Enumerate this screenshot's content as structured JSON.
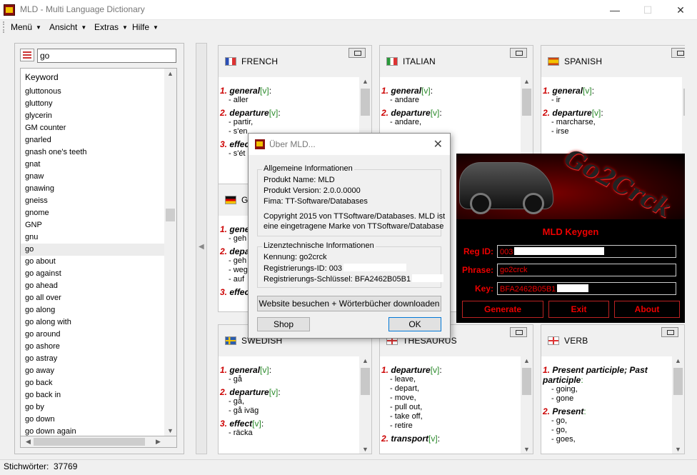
{
  "window": {
    "title": "MLD - Multi Language Dictionary",
    "minimize": "—",
    "maximize": "☐",
    "close": "✕"
  },
  "menu": [
    {
      "label": "Menü"
    },
    {
      "label": "Ansicht"
    },
    {
      "label": "Extras"
    },
    {
      "label": "Hilfe"
    }
  ],
  "search": {
    "value": "go"
  },
  "keywords": {
    "header": "Keyword",
    "items": [
      "gluttonous",
      "gluttony",
      "glycerin",
      "GM counter",
      "gnarled",
      "gnash one's teeth",
      "gnat",
      "gnaw",
      "gnawing",
      "gneiss",
      "gnome",
      "GNP",
      "gnu",
      "go",
      "go about",
      "go against",
      "go ahead",
      "go all over",
      "go along",
      "go along with",
      "go around",
      "go ashore",
      "go astray",
      "go away",
      "go back",
      "go back in",
      "go by",
      "go down",
      "go down again"
    ],
    "selected": "go"
  },
  "panels": [
    {
      "title": "FRENCH",
      "flag": "fr",
      "entries": [
        {
          "num": "1.",
          "term": "general",
          "tag": "[v]",
          "subs": [
            "- aller"
          ]
        },
        {
          "num": "2.",
          "term": "departure",
          "tag": "[v]",
          "subs": [
            "- partir,",
            "- s'en"
          ]
        },
        {
          "num": "3.",
          "term": "effec",
          "tag": "",
          "subs": [
            "- s'ét"
          ]
        }
      ]
    },
    {
      "title": "ITALIAN",
      "flag": "it",
      "entries": [
        {
          "num": "1.",
          "term": "general",
          "tag": "[v]",
          "subs": [
            "- andare"
          ]
        },
        {
          "num": "2.",
          "term": "departure",
          "tag": "[v]",
          "subs": [
            "- andare,"
          ]
        }
      ]
    },
    {
      "title": "SPANISH",
      "flag": "es",
      "entries": [
        {
          "num": "1.",
          "term": "general",
          "tag": "[v]",
          "subs": [
            "- ir"
          ]
        },
        {
          "num": "2.",
          "term": "departure",
          "tag": "[v]",
          "subs": [
            "- marcharse,",
            "- irse"
          ]
        }
      ]
    },
    {
      "title": "GE",
      "flag": "de",
      "entries": [
        {
          "num": "1.",
          "term": "gene",
          "tag": "",
          "subs": [
            "- geh"
          ]
        },
        {
          "num": "2.",
          "term": "depa",
          "tag": "",
          "subs": [
            "- geh",
            "- weg",
            "- auf"
          ]
        },
        {
          "num": "3.",
          "term": "effec",
          "tag": "",
          "subs": []
        }
      ]
    },
    {
      "title": "SWEDISH",
      "flag": "se",
      "entries": [
        {
          "num": "1.",
          "term": "general",
          "tag": "[v]",
          "subs": [
            "- gå"
          ]
        },
        {
          "num": "2.",
          "term": "departure",
          "tag": "[v]",
          "subs": [
            "- gå,",
            "- gå iväg"
          ]
        },
        {
          "num": "3.",
          "term": "effect",
          "tag": "[v]",
          "subs": [
            "- räcka"
          ]
        }
      ]
    },
    {
      "title": "THESAURUS",
      "flag": "en",
      "entries": [
        {
          "num": "1.",
          "term": "departure",
          "tag": "[v]",
          "subs": [
            "- leave,",
            "- depart,",
            "- move,",
            "- pull out,",
            "- take off,",
            "- retire"
          ]
        },
        {
          "num": "2.",
          "term": "transport",
          "tag": "[v]",
          "subs": []
        }
      ]
    },
    {
      "title": "VERB",
      "flag": "en",
      "entries": [
        {
          "num": "1.",
          "term": "Present participle; Past participle",
          "tag": ":",
          "subs": [
            "- going,",
            "- gone"
          ]
        },
        {
          "num": "2.",
          "term": "Present",
          "tag": ":",
          "subs": [
            "- go,",
            "- go,",
            "- goes,"
          ]
        }
      ]
    }
  ],
  "dialog": {
    "title": "Über MLD...",
    "group1": {
      "label": "Allgemeine Informationen",
      "product_name": "Produkt Name: MLD",
      "product_version": "Produkt Version: 2.0.0.0000",
      "company": "Fima: TT-Software/Databases",
      "copyright1": "Copyright 2015 von TTSoftware/Databases. MLD ist",
      "copyright2": "eine eingetragene Marke von TTSoftware/Database"
    },
    "group2": {
      "label": "Lizenztechnische Informationen",
      "kennung": "Kennung: go2crck",
      "reg_id": "Registrierungs-ID: 003",
      "reg_key": "Registrierungs-Schlüssel: BFA2462B05B1"
    },
    "website_button": "Website besuchen + Wörterbücher downloaden",
    "shop_button": "Shop",
    "ok_button": "OK"
  },
  "keygen": {
    "logo": "Go2Crck",
    "title": "MLD Keygen",
    "reg_id_label": "Reg ID:",
    "reg_id_value": "003",
    "phrase_label": "Phrase:",
    "phrase_value": "go2crck",
    "key_label": "Key:",
    "key_value": "BFA2462B05B1",
    "generate": "Generate",
    "exit": "Exit",
    "about": "About"
  },
  "status": {
    "label": "Stichwörter:",
    "count": "37769"
  },
  "colors": {
    "accent_red": "#cc0000",
    "tag_green": "#2a8a2a",
    "keygen_red": "#ee0000"
  }
}
